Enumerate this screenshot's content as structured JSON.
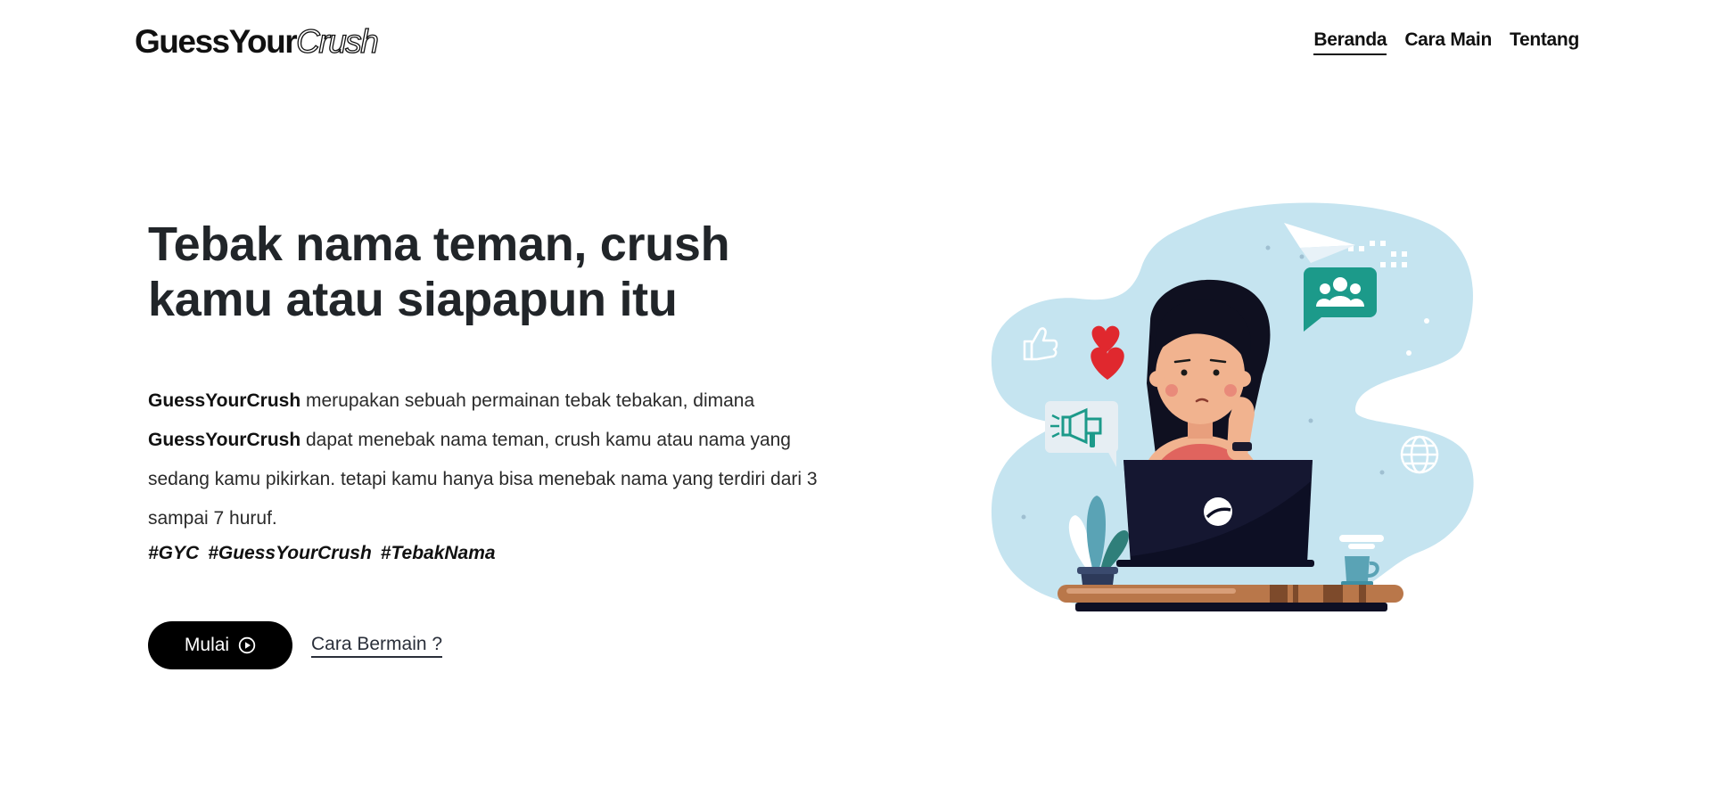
{
  "header": {
    "logo": {
      "part1": "GuessYour",
      "part2": "Crush"
    },
    "nav": [
      {
        "label": "Beranda",
        "active": true
      },
      {
        "label": "Cara Main",
        "active": false
      },
      {
        "label": "Tentang",
        "active": false
      }
    ]
  },
  "hero": {
    "title": "Tebak nama teman, crush kamu atau siapapun itu",
    "description": {
      "brand1": "GuessYourCrush",
      "text1": " merupakan sebuah permainan tebak tebakan, dimana ",
      "brand2": "GuessYourCrush",
      "text2": " dapat menebak nama teman, crush kamu atau nama yang sedang kamu pikirkan. tetapi kamu hanya bisa menebak nama yang terdiri dari 3 sampai 7 huruf."
    },
    "tags": [
      "#GYC",
      "#GuessYourCrush",
      "#TebakNama"
    ],
    "start_button": {
      "label": "Mulai",
      "icon": "play-circle-icon"
    },
    "how_to_link": "Cara Bermain ?"
  },
  "colors": {
    "text": "#212529",
    "button_bg": "#000000",
    "blob": "#c5e4f0",
    "teal": "#1c9a8a",
    "heart": "#e0282e",
    "shirt": "#e0645e",
    "skin": "#f1b38f",
    "desk": "#b9774a"
  }
}
